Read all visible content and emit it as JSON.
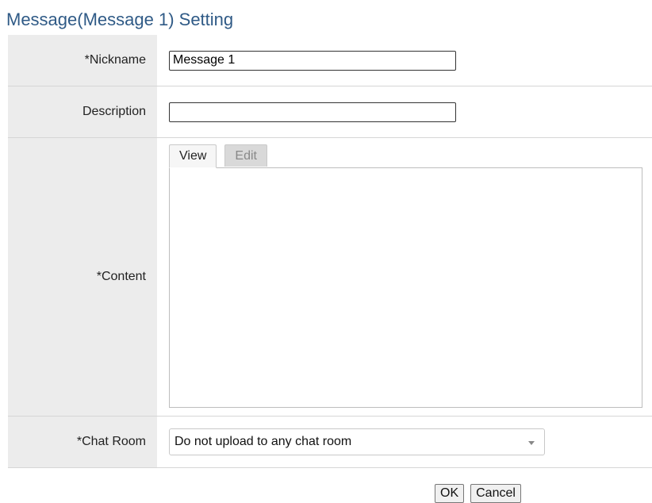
{
  "page": {
    "title": "Message(Message 1) Setting"
  },
  "form": {
    "nickname": {
      "label": "*Nickname",
      "value": "Message 1"
    },
    "description": {
      "label": "Description",
      "value": ""
    },
    "content": {
      "label": "*Content",
      "tabs": [
        {
          "label": "View",
          "active": true
        },
        {
          "label": "Edit",
          "active": false
        }
      ]
    },
    "chat_room": {
      "label": "*Chat Room",
      "selected": "Do not upload to any chat room"
    }
  },
  "buttons": {
    "ok_label": "OK",
    "cancel_label": "Cancel"
  },
  "colors": {
    "title": "#2f5a86",
    "label_background": "#ececec",
    "active_tab": "#f6f6f6",
    "inactive_tab": "#d9d9d9"
  },
  "icons": {
    "dropdown": "chevron-down-icon"
  }
}
